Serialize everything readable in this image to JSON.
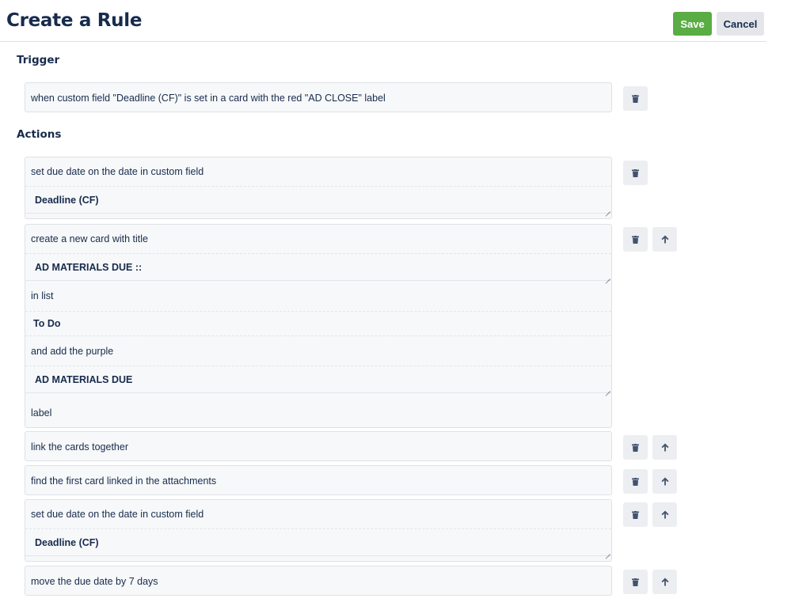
{
  "header": {
    "title": "Create a Rule",
    "save_label": "Save",
    "cancel_label": "Cancel",
    "save_color": "#5aac44"
  },
  "trigger": {
    "title": "Trigger",
    "text": "when custom field \"Deadline (CF)\" is set in a card with the red \"AD CLOSE\" label"
  },
  "actions": {
    "title": "Actions",
    "items": [
      {
        "text": "set due date on the date in custom field",
        "field": "Deadline (CF)"
      },
      {
        "text": "create a new card with title",
        "title_field": "AD MATERIALS DUE ::",
        "list_label": "in list",
        "list_value": "To Do",
        "label_text": "and add the purple",
        "label_field": "AD MATERIALS DUE",
        "label_suffix": "label"
      },
      {
        "text": "link the cards together"
      },
      {
        "text": "find the first card linked in the attachments"
      },
      {
        "text": "set due date on the date in custom field",
        "field": "Deadline (CF)"
      },
      {
        "text": "move the due date by 7 days"
      }
    ]
  },
  "icons": {
    "delete": "trash-icon",
    "move_up": "arrow-up-icon"
  }
}
